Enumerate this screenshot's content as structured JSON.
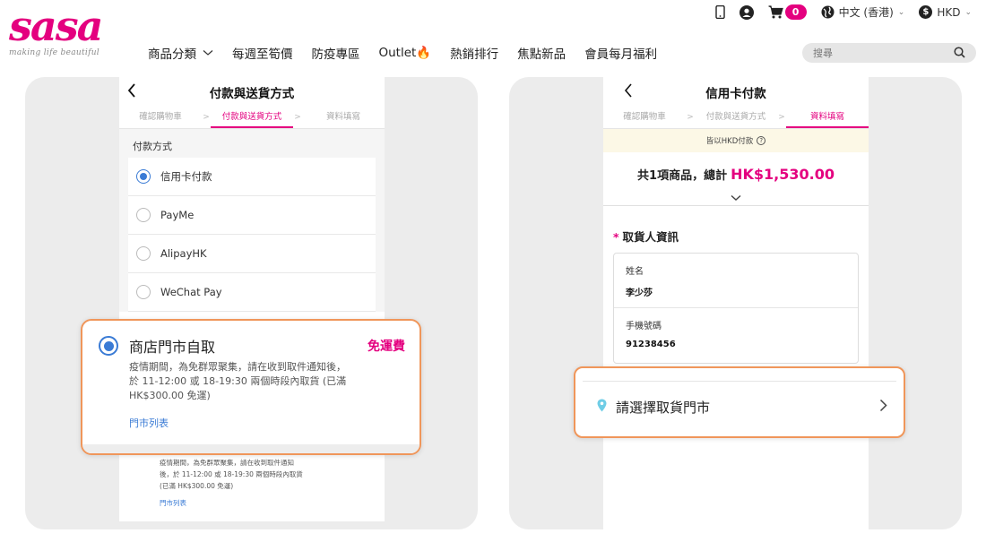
{
  "brand": {
    "name": "sasa",
    "tagline": "making life beautiful",
    "accent": "#e4007f"
  },
  "header": {
    "cart_count": "0",
    "language": "中文 (香港)",
    "currency": "HKD",
    "icons": [
      "mobile-icon",
      "user-icon",
      "cart-icon",
      "globe-icon",
      "dollar-icon"
    ]
  },
  "nav": {
    "items": [
      "商品分類",
      "每週至筍價",
      "防疫專區",
      "Outlet🔥",
      "熱銷排行",
      "焦點新品",
      "會員每月福利"
    ]
  },
  "search": {
    "placeholder": "搜尋"
  },
  "left_screen": {
    "title": "付款與送貨方式",
    "steps": [
      "確認購物車",
      "付款與送貨方式",
      "資料填寫"
    ],
    "active_step": 1,
    "payment_label": "付款方式",
    "payment_options": [
      "信用卡付款",
      "PayMe",
      "AlipayHK",
      "WeChat Pay"
    ],
    "selected_payment": "信用卡付款",
    "pickup_bg": {
      "desc_line1": "疫情期間，為免群眾聚集，請在收到取件通知",
      "desc_line2": "後，於 11-12:00 或 18-19:30 兩個時段內取貨",
      "desc_line3": "(已滿 HK$300.00 免運)",
      "link": "門市列表"
    },
    "callout": {
      "title": "商店門市自取",
      "badge": "免運費",
      "desc": "疫情期間，為免群眾聚集，請在收到取件通知後，於 11-12:00 或 18-19:30 兩個時段內取貨 (已滿 HK$300.00 免運)",
      "link": "門市列表"
    }
  },
  "right_screen": {
    "title": "信用卡付款",
    "steps": [
      "確認購物車",
      "付款與送貨方式",
      "資料填寫"
    ],
    "active_step": 2,
    "notice": "皆以HKD付款",
    "total_prefix": "共1項商品，總計",
    "total_amount": "HK$1,530.00",
    "consignee_title": "取貨人資訊",
    "name_label": "姓名",
    "name_value": "李少莎",
    "phone_label": "手機號碼",
    "phone_value": "91238456",
    "callout": {
      "label": "請選擇取貨門市"
    }
  },
  "colors": {
    "callout_border": "#f0965a",
    "radio_blue": "#3a7bd5",
    "panel_bg": "#ececec"
  }
}
